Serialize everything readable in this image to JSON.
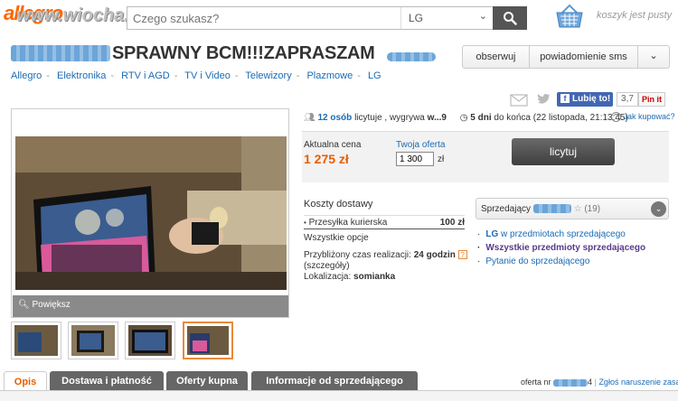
{
  "header": {
    "logo": "allegro",
    "watermark": "www.wiocha.pl",
    "search_placeholder": "Czego szukasz?",
    "category": "LG",
    "cart_text": "koszyk jest pusty"
  },
  "listing": {
    "title": "SPRAWNY BCM!!!ZAPRASZAM",
    "follow_label": "obserwuj",
    "sms_label": "powiadomienie sms"
  },
  "breadcrumbs": [
    "Allegro",
    "Elektronika",
    "RTV i AGD",
    "TV i Video",
    "Telewizory",
    "Plazmowe",
    "LG"
  ],
  "social": {
    "fb_label": "Lubię to!",
    "fb_count": "3,7",
    "pin_label": "Pin it"
  },
  "gallery": {
    "enlarge_label": "Powiększ"
  },
  "auction": {
    "bidders_count": "12 osób",
    "bidders_text": "licytuje , wygrywa",
    "winner": "w...9",
    "days_left": "5 dni",
    "end_text": "do końca (22 listopada, 21:13:45)",
    "how_to_buy": "Jak kupować?",
    "price_label": "Aktualna cena",
    "price": "1 275 zł",
    "your_offer_label": "Twoja oferta",
    "offer_value": "1 300",
    "currency": "zł",
    "bid_button": "licytuj"
  },
  "shipping": {
    "heading": "Koszty dostawy",
    "method": "Przesyłka kurierska",
    "cost": "100 zł",
    "all_options": "Wszystkie opcje",
    "time_label": "Przybliżony czas realizacji:",
    "time_value": "24 godzin",
    "details": "(szczegóły)",
    "location_label": "Lokalizacja:",
    "location": "somianka"
  },
  "seller": {
    "label": "Sprzedający",
    "rating": "(19)",
    "link_brand": "LG",
    "link_items": "w przedmiotach sprzedającego",
    "link_all": "Wszystkie przedmioty sprzedającego",
    "link_ask": "Pytanie do sprzedającego"
  },
  "tabs": [
    "Opis",
    "Dostawa i płatność",
    "Oferty kupna",
    "Informacje od sprzedającego"
  ],
  "footer": {
    "offer_no_label": "oferta nr",
    "offer_no_tail": "4",
    "report": "Zgłoś naruszenie zasad"
  }
}
